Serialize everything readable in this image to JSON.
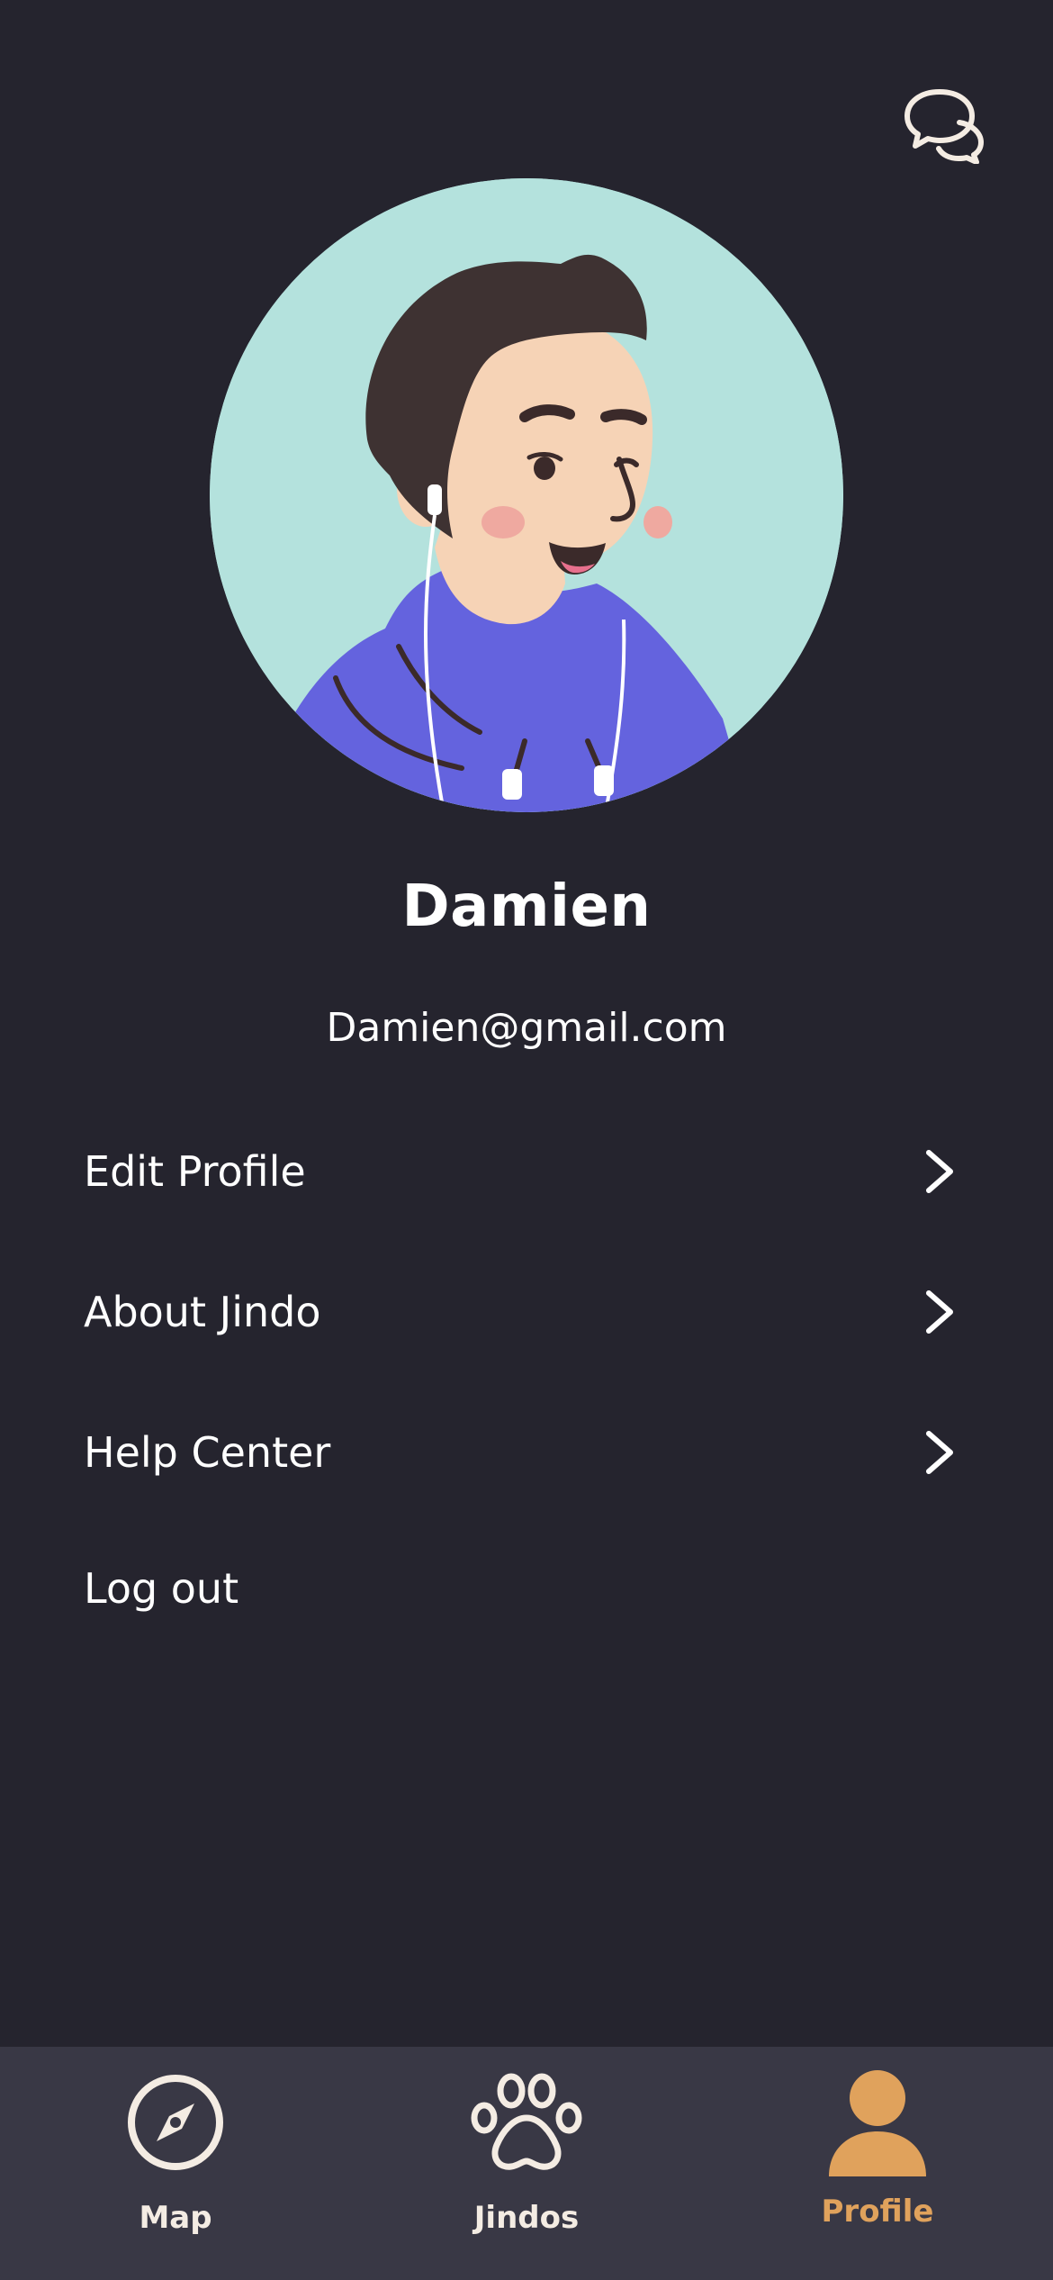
{
  "header": {
    "chat_icon": "chat-bubbles-icon"
  },
  "profile": {
    "avatar": "cartoon-avatar",
    "name": "Damien",
    "email": "Damien@gmail.com"
  },
  "menu": {
    "items": [
      {
        "label": "Edit Profile",
        "icon": "chevron-right-icon"
      },
      {
        "label": "About Jindo",
        "icon": "chevron-right-icon"
      },
      {
        "label": "Help Center",
        "icon": "chevron-right-icon"
      },
      {
        "label": "Log out"
      }
    ]
  },
  "tabbar": {
    "tabs": [
      {
        "label": "Map",
        "icon": "compass-icon",
        "active": false
      },
      {
        "label": "Jindos",
        "icon": "paw-icon",
        "active": false
      },
      {
        "label": "Profile",
        "icon": "person-icon",
        "active": true
      }
    ]
  },
  "colors": {
    "background": "#25242e",
    "tabbar_background": "#393845",
    "accent": "#e0a25c",
    "inactive_tab": "#f4ece3",
    "avatar_background": "#b4e2dd"
  }
}
